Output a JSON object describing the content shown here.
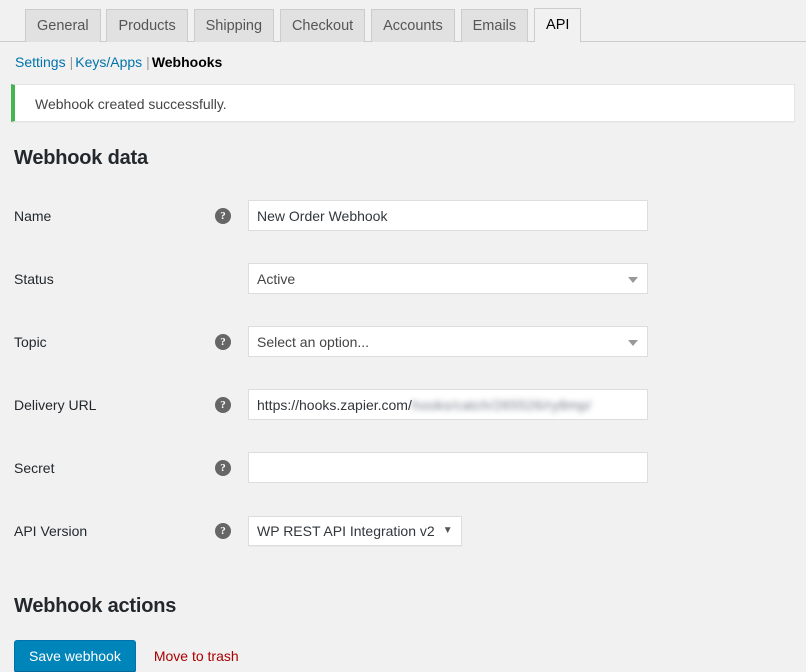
{
  "tabs": [
    {
      "label": "General",
      "active": false
    },
    {
      "label": "Products",
      "active": false
    },
    {
      "label": "Shipping",
      "active": false
    },
    {
      "label": "Checkout",
      "active": false
    },
    {
      "label": "Accounts",
      "active": false
    },
    {
      "label": "Emails",
      "active": false
    },
    {
      "label": "API",
      "active": true
    }
  ],
  "subnav": {
    "settings": "Settings",
    "keys_apps": "Keys/Apps",
    "webhooks": "Webhooks",
    "separator": "|"
  },
  "notice": {
    "message": "Webhook created successfully.",
    "accent_color": "#46b450"
  },
  "sections": {
    "data_title": "Webhook data",
    "actions_title": "Webhook actions"
  },
  "fields": {
    "name": {
      "label": "Name",
      "value": "New Order Webhook",
      "help_icon": "help-icon"
    },
    "status": {
      "label": "Status",
      "value": "Active"
    },
    "topic": {
      "label": "Topic",
      "value": "Select an option...",
      "help_icon": "help-icon"
    },
    "delivery_url": {
      "label": "Delivery URL",
      "value_visible": "https://hooks.zapier.com/",
      "value_redacted": "hooks/catch/265526/ry8mp/",
      "help_icon": "help-icon"
    },
    "secret": {
      "label": "Secret",
      "value": "",
      "help_icon": "help-icon"
    },
    "api_version": {
      "label": "API Version",
      "value": "WP REST API Integration v2",
      "help_icon": "help-icon",
      "arrow_glyph": "▼"
    }
  },
  "buttons": {
    "save": "Save webhook",
    "trash": "Move to trash",
    "save_color": "#0085ba",
    "trash_color": "#a00"
  }
}
